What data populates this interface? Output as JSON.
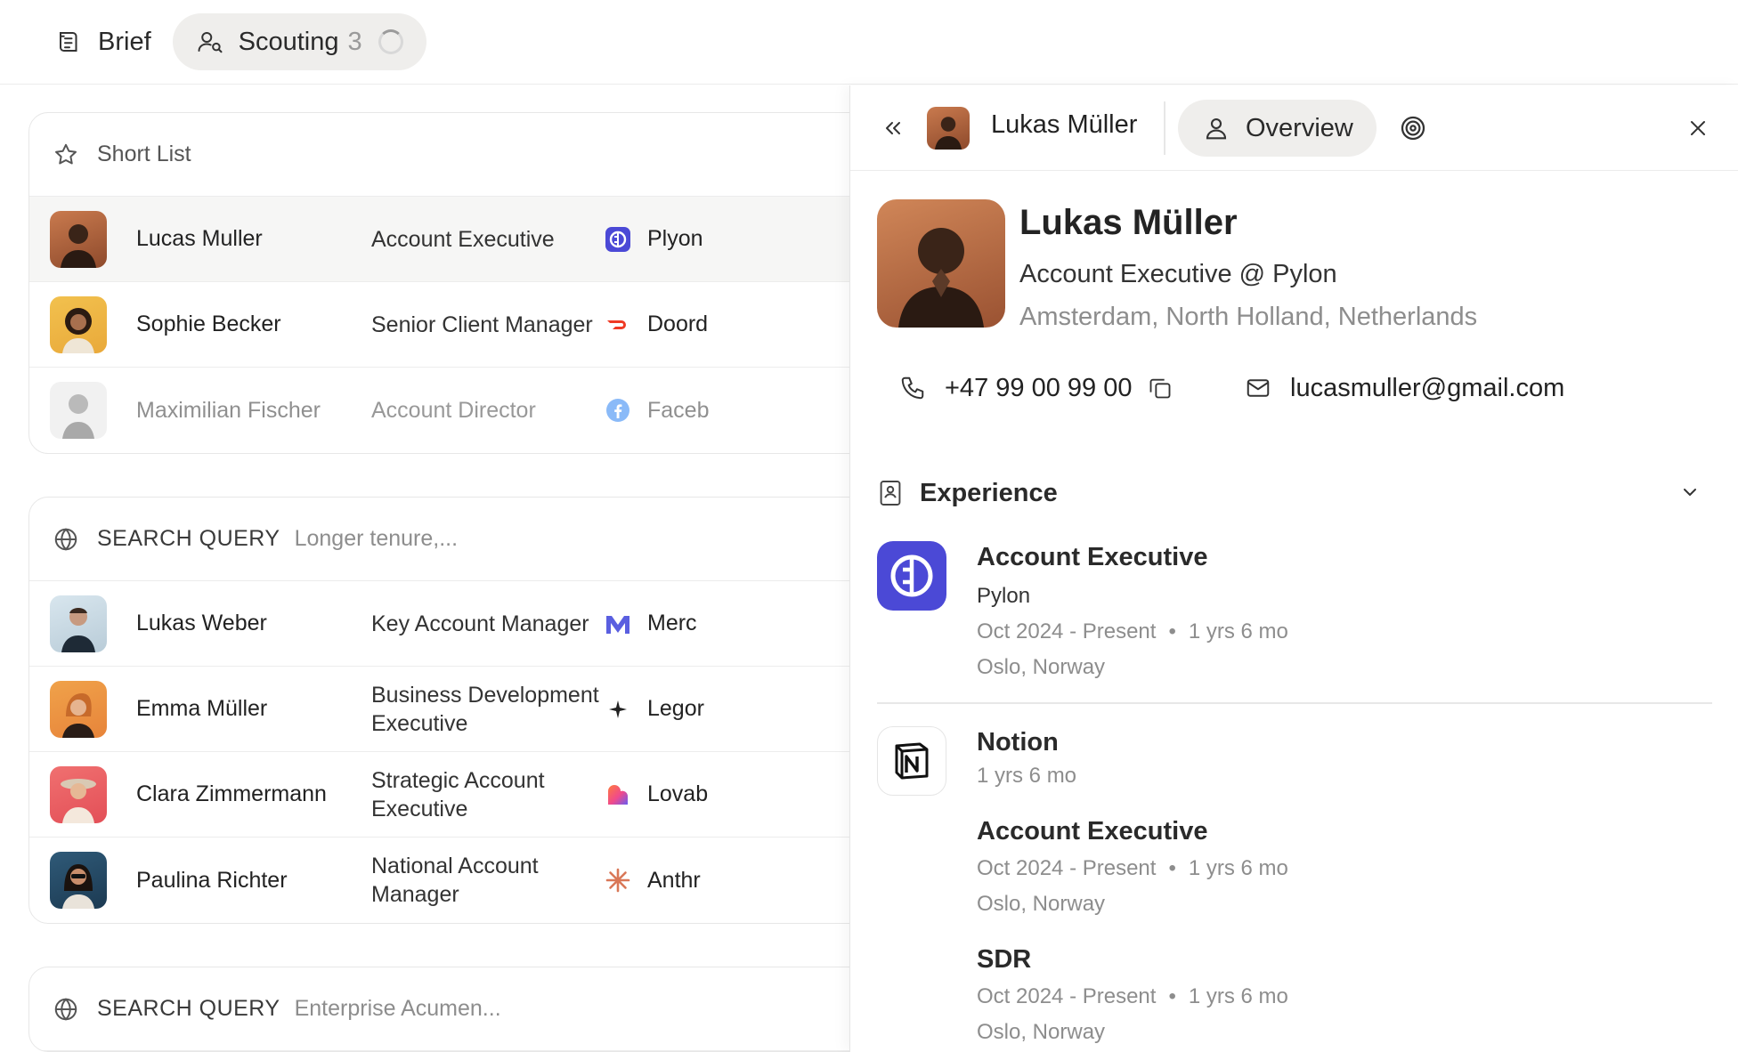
{
  "topbar": {
    "brief_label": "Brief",
    "scouting_label": "Scouting",
    "scouting_count": "3"
  },
  "short_list": {
    "title": "Short List",
    "rows": [
      {
        "name": "Lucas Muller",
        "role": "Account Executive",
        "company": "Plyon",
        "selected": true
      },
      {
        "name": "Sophie Becker",
        "role": "Senior Client Manager",
        "company": "Doord"
      },
      {
        "name": "Maximilian Fischer",
        "role": "Account Director",
        "company": "Faceb",
        "dimmed": true
      }
    ]
  },
  "query1": {
    "label": "SEARCH QUERY",
    "text": "Longer tenure,...",
    "rows": [
      {
        "name": "Lukas Weber",
        "role": "Key Account Manager",
        "company": "Merc"
      },
      {
        "name": "Emma Müller",
        "role": "Business Development Executive",
        "company": "Legor"
      },
      {
        "name": "Clara Zimmermann",
        "role": "Strategic Account Executive",
        "company": "Lovab"
      },
      {
        "name": "Paulina Richter",
        "role": "National Account Manager",
        "company": "Anthr"
      }
    ]
  },
  "query2": {
    "label": "SEARCH QUERY",
    "text": "Enterprise Acumen..."
  },
  "panel": {
    "header_name": "Lukas Müller",
    "overview_tab": "Overview",
    "profile": {
      "name": "Lukas Müller",
      "title": "Account Executive @ Pylon",
      "location": "Amsterdam, North Holland, Netherlands",
      "phone": "+47 99 00 99 00",
      "email": "lucasmuller@gmail.com"
    },
    "experience": {
      "heading": "Experience",
      "entries": [
        {
          "title": "Account Executive",
          "company": "Pylon",
          "dates": "Oct 2024 - Present",
          "duration": "1 yrs 6 mo",
          "location": "Oslo, Norway"
        },
        {
          "company": "Notion",
          "total": "1 yrs 6 mo",
          "roles": [
            {
              "title": "Account Executive",
              "dates": "Oct 2024 - Present",
              "duration": "1 yrs 6 mo",
              "location": "Oslo, Norway"
            },
            {
              "title": "SDR",
              "dates": "Oct 2024 - Present",
              "duration": "1 yrs 6 mo",
              "location": "Oslo, Norway"
            }
          ]
        }
      ]
    }
  },
  "colors": {
    "pylon": "#4b49d6",
    "doordash": "#ef3a24",
    "facebook": "#1877f2",
    "mercury": "#5a5fe0",
    "anthropic": "#d97757",
    "pill_bg": "#efeeec"
  },
  "icons": [
    "brief-icon",
    "user-search-icon",
    "spinner-icon",
    "star-icon",
    "globe-icon",
    "chevrons-left-icon",
    "user-icon",
    "target-icon",
    "close-icon",
    "phone-icon",
    "copy-icon",
    "mail-icon",
    "contact-book-icon",
    "chevron-down-icon"
  ]
}
